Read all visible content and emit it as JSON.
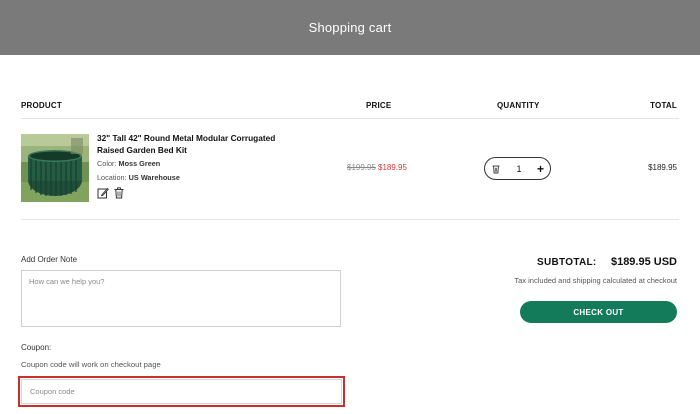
{
  "page_title": "Shopping cart",
  "table_headers": {
    "product": "PRODUCT",
    "price": "PRICE",
    "quantity": "QUANTITY",
    "total": "TOTAL"
  },
  "item": {
    "name": "32\" Tall 42\" Round Metal Modular Corrugated Raised Garden Bed Kit",
    "color_label": "Color:",
    "color_value": "Moss Green",
    "location_label": "Location:",
    "location_value": "US Warehouse",
    "compare_price": "$199.95",
    "price": "$189.95",
    "quantity": "1",
    "line_total": "$189.95",
    "thumb_icon": "raised-garden-bed-image"
  },
  "order_note": {
    "label": "Add Order Note",
    "placeholder": "How can we help you?"
  },
  "coupon": {
    "label": "Coupon:",
    "hint": "Coupon code will work on checkout page",
    "placeholder": "Coupon code"
  },
  "summary": {
    "subtotal_label": "SUBTOTAL:",
    "subtotal_value": "$189.95 USD",
    "tax_note": "Tax included and shipping calculated at checkout",
    "checkout_label": "CHECK OUT"
  },
  "colors": {
    "banner": "#7a7a7a",
    "checkout": "#137a5a",
    "sale_price": "#d23a3a",
    "highlight_border": "#c9302c"
  }
}
